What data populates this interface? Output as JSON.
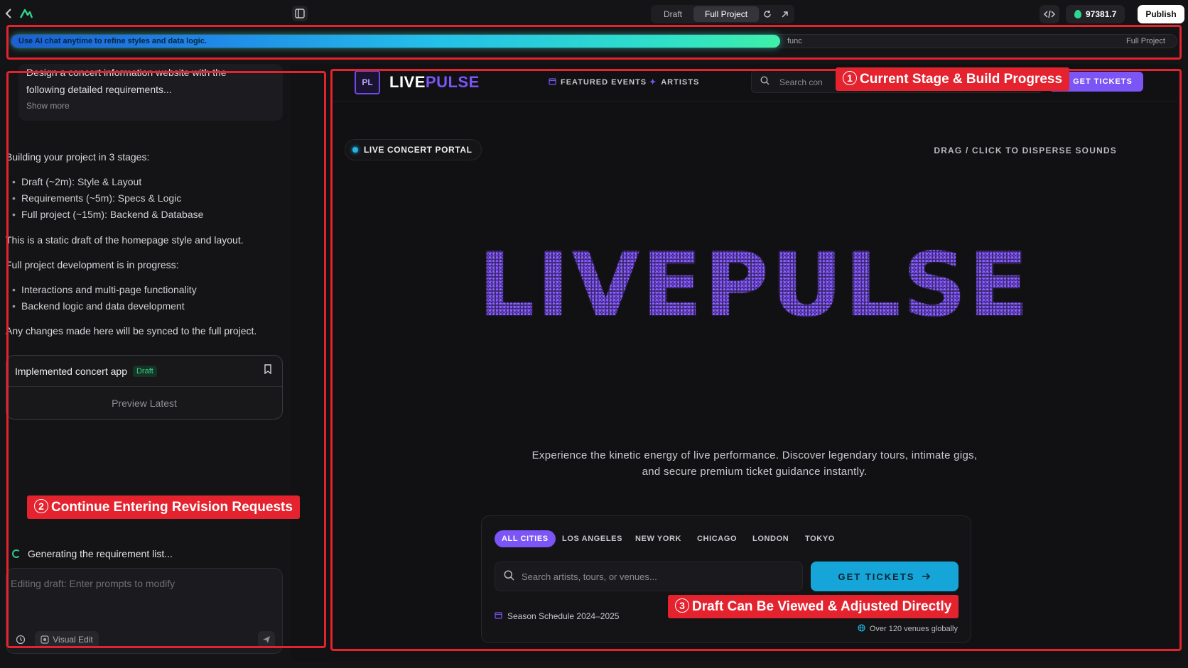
{
  "topbar": {
    "back_icon": "chevron-left-icon",
    "logo_icon": "app-logo-icon",
    "sidebar_toggle_icon": "sidebar-toggle-icon",
    "mode_draft": "Draft",
    "mode_full": "Full Project",
    "refresh_icon": "refresh-icon",
    "open_external_icon": "external-link-icon",
    "code_icon": "code-icon",
    "credits_icon": "credit-drop-icon",
    "credits": "97381.7",
    "publish": "Publish"
  },
  "progress": {
    "message": "Use AI chat anytime to refine styles and data logic.",
    "stage_label": "func",
    "end_label": "Full Project",
    "percent": 66
  },
  "chat": {
    "prompt_lines": [
      "Design a concert information website with the",
      "following detailed requirements..."
    ],
    "show_more": "Show more",
    "intro": "Building your project in 3 stages:",
    "stages": [
      "Draft (~2m): Style & Layout",
      "Requirements (~5m): Specs & Logic",
      "Full project (~15m): Backend & Database"
    ],
    "static_note": "This is a static draft of the homepage style and layout.",
    "progress_note": "Full project development is in progress:",
    "progress_items": [
      "Interactions and multi-page functionality",
      "Backend logic and data development"
    ],
    "sync_note": "Any changes made here will be synced to the full project.",
    "impl_title": "Implemented concert app",
    "impl_tag": "Draft",
    "impl_bookmark_icon": "bookmark-icon",
    "preview_latest": "Preview Latest",
    "generating": "Generating the requirement list...",
    "input_placeholder": "Editing draft: Enter prompts to modify",
    "history_icon": "history-icon",
    "visual_edit": "Visual Edit",
    "visual_edit_icon": "visual-edit-icon",
    "send_icon": "send-icon"
  },
  "site": {
    "logo_text": "PL",
    "brand_a": "LIVE",
    "brand_b": "PULSE",
    "nav": [
      "FEATURED EVENTS",
      "ARTISTS"
    ],
    "search_placeholder": "Search con",
    "get_tickets_top": "GET TICKETS",
    "portal_badge": "LIVE CONCERT PORTAL",
    "disperse": "DRAG / CLICK TO DISPERSE SOUNDS",
    "hero": "LIVEPULSE",
    "tagline": "Experience the kinetic energy of live performance. Discover legendary tours, intimate gigs, and secure premium ticket guidance instantly.",
    "cities": [
      "ALL CITIES",
      "LOS ANGELES",
      "NEW YORK",
      "CHICAGO",
      "LONDON",
      "TOKYO"
    ],
    "panel_search_placeholder": "Search artists, tours, or venues...",
    "get_tickets_main": "GET TICKETS",
    "season": "Season Schedule 2024–2025",
    "venues": "Over 120 venues globally",
    "accent": "#7b55f5",
    "cyan": "#16a5d8"
  },
  "annotations": {
    "one_num": "1",
    "one": "Current Stage & Build Progress",
    "two_num": "2",
    "two": "Continue Entering Revision Requests",
    "three_num": "3",
    "three": "Draft Can Be Viewed & Adjusted Directly",
    "color": "#e4232f"
  }
}
